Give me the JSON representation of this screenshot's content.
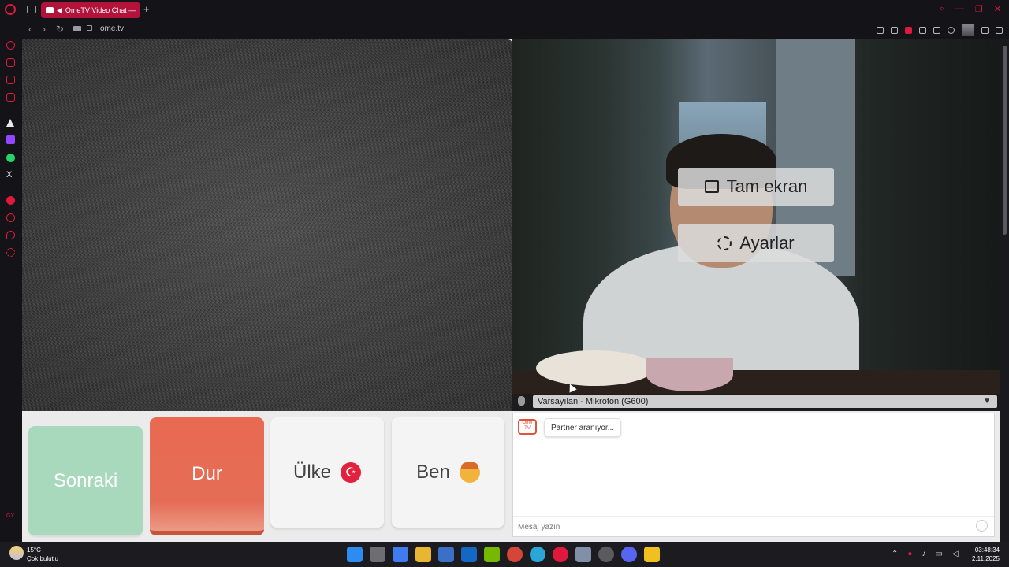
{
  "browser": {
    "tab_title": "OmeTV Video Chat —",
    "new_tab_label": "+",
    "url": "ome.tv",
    "nav": {
      "back": "‹",
      "forward": "›",
      "reload": "↻"
    },
    "window_controls": [
      "⌕",
      "—",
      "❐",
      "✕"
    ]
  },
  "sidebar": {
    "icons": [
      "opera-refresh-icon",
      "aria-icon",
      "messenger-icon",
      "instagram-icon",
      "vk-icon",
      "twitch-icon",
      "whatsapp-icon",
      "x-icon",
      "music-icon",
      "history-icon",
      "pinboard-icon",
      "settings-icon"
    ],
    "gx_label": "GX",
    "more_label": "..."
  },
  "video": {
    "fullscreen_label": "Tam ekran",
    "settings_label": "Ayarlar",
    "microphone_select": "Varsayılan - Mikrofon (G600)"
  },
  "controls": {
    "next_label": "Sonraki",
    "stop_label": "Dur",
    "country_label": "Ülke",
    "country_flag": "☪",
    "me_label": "Ben"
  },
  "chat": {
    "logo_text": "Ome TV",
    "status_message": "Partner aranıyor...",
    "input_placeholder": "Mesaj yazın"
  },
  "taskbar": {
    "temperature": "15°C",
    "weather": "Çok bulutlu",
    "time": "03:48:34",
    "date": "2.11.2025"
  },
  "colors": {
    "accent": "#e0183c",
    "next_button": "#a8d9bd",
    "stop_button": "#e86a51"
  }
}
